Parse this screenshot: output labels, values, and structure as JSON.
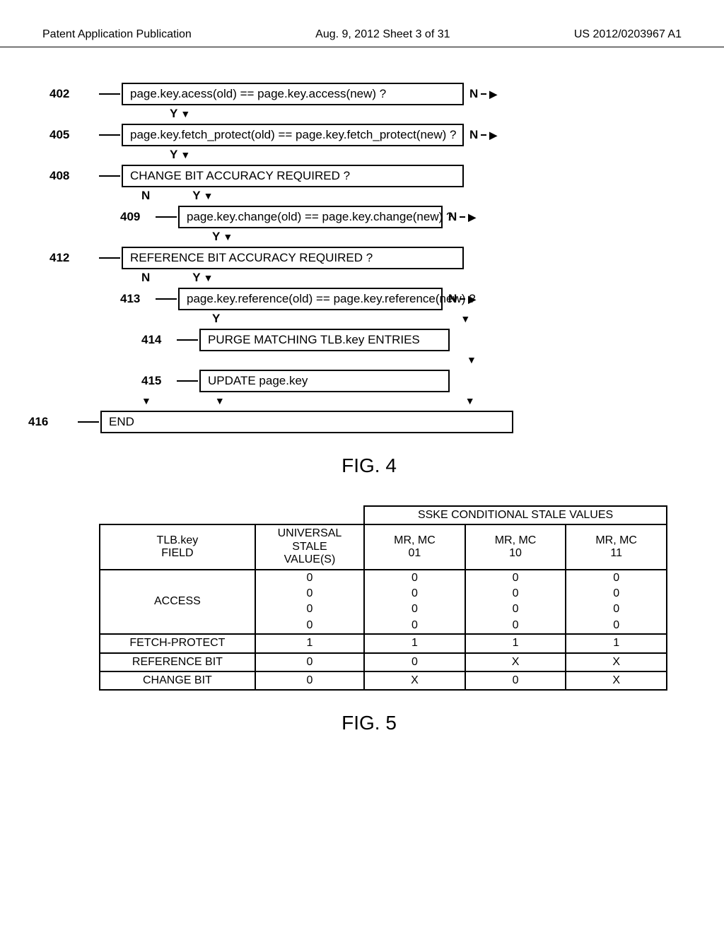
{
  "header": {
    "left": "Patent Application Publication",
    "center": "Aug. 9, 2012  Sheet 3 of 31",
    "right": "US 2012/0203967 A1"
  },
  "flow": {
    "r402": {
      "ref": "402",
      "text": "page.key.acess(old) == page.key.access(new) ?",
      "y": "Y",
      "n": "N"
    },
    "r405": {
      "ref": "405",
      "text": "page.key.fetch_protect(old) == page.key.fetch_protect(new) ?",
      "y": "Y",
      "n": "N"
    },
    "r408": {
      "ref": "408",
      "text": "CHANGE BIT ACCURACY REQUIRED ?",
      "y": "Y",
      "n": "N"
    },
    "r409": {
      "ref": "409",
      "text": "page.key.change(old) == page.key.change(new) ?",
      "y": "Y",
      "n": "N"
    },
    "r412": {
      "ref": "412",
      "text": "REFERENCE BIT ACCURACY REQUIRED ?",
      "y": "Y",
      "n": "N"
    },
    "r413": {
      "ref": "413",
      "text": "page.key.reference(old) == page.key.reference(new) ?",
      "y": "Y",
      "n": "N"
    },
    "r414": {
      "ref": "414",
      "text": "PURGE MATCHING TLB.key ENTRIES"
    },
    "r415": {
      "ref": "415",
      "text": "UPDATE page.key"
    },
    "r416": {
      "ref": "416",
      "text": "END"
    }
  },
  "fig4_label": "FIG. 4",
  "fig5_label": "FIG. 5",
  "table": {
    "header_span": "SSKE CONDITIONAL STALE VALUES",
    "col_field": "TLB.key\nFIELD",
    "col_univ": "UNIVERSAL\nSTALE\nVALUE(S)",
    "col_mrmc01": "MR, MC\n01",
    "col_mrmc10": "MR, MC\n10",
    "col_mrmc11": "MR, MC\n11",
    "rows": {
      "access": {
        "label": "ACCESS",
        "univ": [
          "0",
          "0",
          "0",
          "0"
        ],
        "c01": [
          "0",
          "0",
          "0",
          "0"
        ],
        "c10": [
          "0",
          "0",
          "0",
          "0"
        ],
        "c11": [
          "0",
          "0",
          "0",
          "0"
        ]
      },
      "fetch": {
        "label": "FETCH-PROTECT",
        "univ": "1",
        "c01": "1",
        "c10": "1",
        "c11": "1"
      },
      "ref": {
        "label": "REFERENCE BIT",
        "univ": "0",
        "c01": "0",
        "c10": "X",
        "c11": "X"
      },
      "chg": {
        "label": "CHANGE BIT",
        "univ": "0",
        "c01": "X",
        "c10": "0",
        "c11": "X"
      }
    }
  }
}
